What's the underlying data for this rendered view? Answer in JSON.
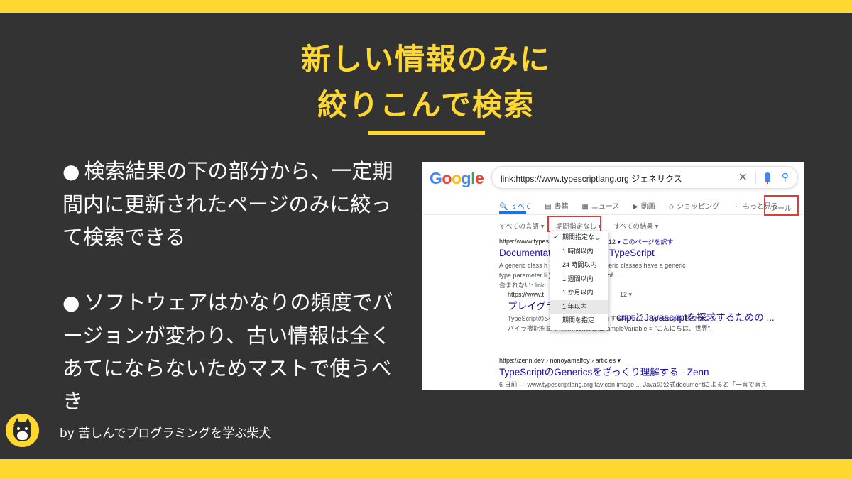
{
  "slide": {
    "title_line1": "新しい情報のみに",
    "title_line2": "絞りこんで検索",
    "bullets": [
      "検索結果の下の部分から、一定期間内に更新されたページのみに絞って検索できる",
      "ソフトウェアはかなりの頻度でバージョンが変わり、古い情報は全くあてにならないためマストで使うべき"
    ],
    "bullet_mark": "●",
    "author": "by 苦しんでプログラミングを学ぶ柴犬",
    "accent_color": "#fed731",
    "background_color": "#333333"
  },
  "screenshot": {
    "logo": [
      "G",
      "o",
      "o",
      "g",
      "l",
      "e"
    ],
    "search_query": "link:https://www.typescriptlang.org ジェネリクス",
    "clear_icon": "close-icon",
    "tabs": [
      {
        "icon": "🔍",
        "label": "すべて"
      },
      {
        "icon": "▤",
        "label": "書籍"
      },
      {
        "icon": "▦",
        "label": "ニュース"
      },
      {
        "icon": "▶",
        "label": "動画"
      },
      {
        "icon": "◇",
        "label": "ショッピング"
      },
      {
        "icon": "⋮",
        "label": "もっと見る"
      }
    ],
    "tools_label": "ツール",
    "filters": [
      "すべての言語 ▾",
      "期間指定なし ▾",
      "すべての結果 ▾"
    ],
    "dropdown_items": [
      "期間指定なし",
      "1 時間以内",
      "24 時間以内",
      "1 週間以内",
      "1 か月以内",
      "1 年以内",
      "期間を指定"
    ],
    "dropdown_checked": "✓",
    "results": [
      {
        "url": "https://www.types",
        "translate": "12 ▾ このページを訳す",
        "title": "Documentat",
        "title_right": "TypeScript",
        "snippet1": "A generic class h                    eneric interface. Generic classes have a generic",
        "snippet2": "type parameter li                    ) following the name of ...",
        "snippet3": "含まれない: link:"
      },
      {
        "url": "https://www.t",
        "url_right": "12 ▾",
        "title": "プレイグラ",
        "title_right": "criptとJavascriptを探求するための ...",
        "snippet1": "TypeScriptのシ                  のURLを他人と共有する場所. // - TypeScriptの様々なコン",
        "snippet2": "パイラ機能を試す場所. const anExampleVariable = \"こんにちは、世界\"."
      },
      {
        "url": "https://zenn.dev › nonoyamalfoy › articles ▾",
        "title": "TypeScriptのGenericsをざっくり理解する - Zenn",
        "snippet1": "6 日前 — www.typescriptlang.org favicon image ... Javaの公式documentによると「一言で言え"
      }
    ]
  }
}
